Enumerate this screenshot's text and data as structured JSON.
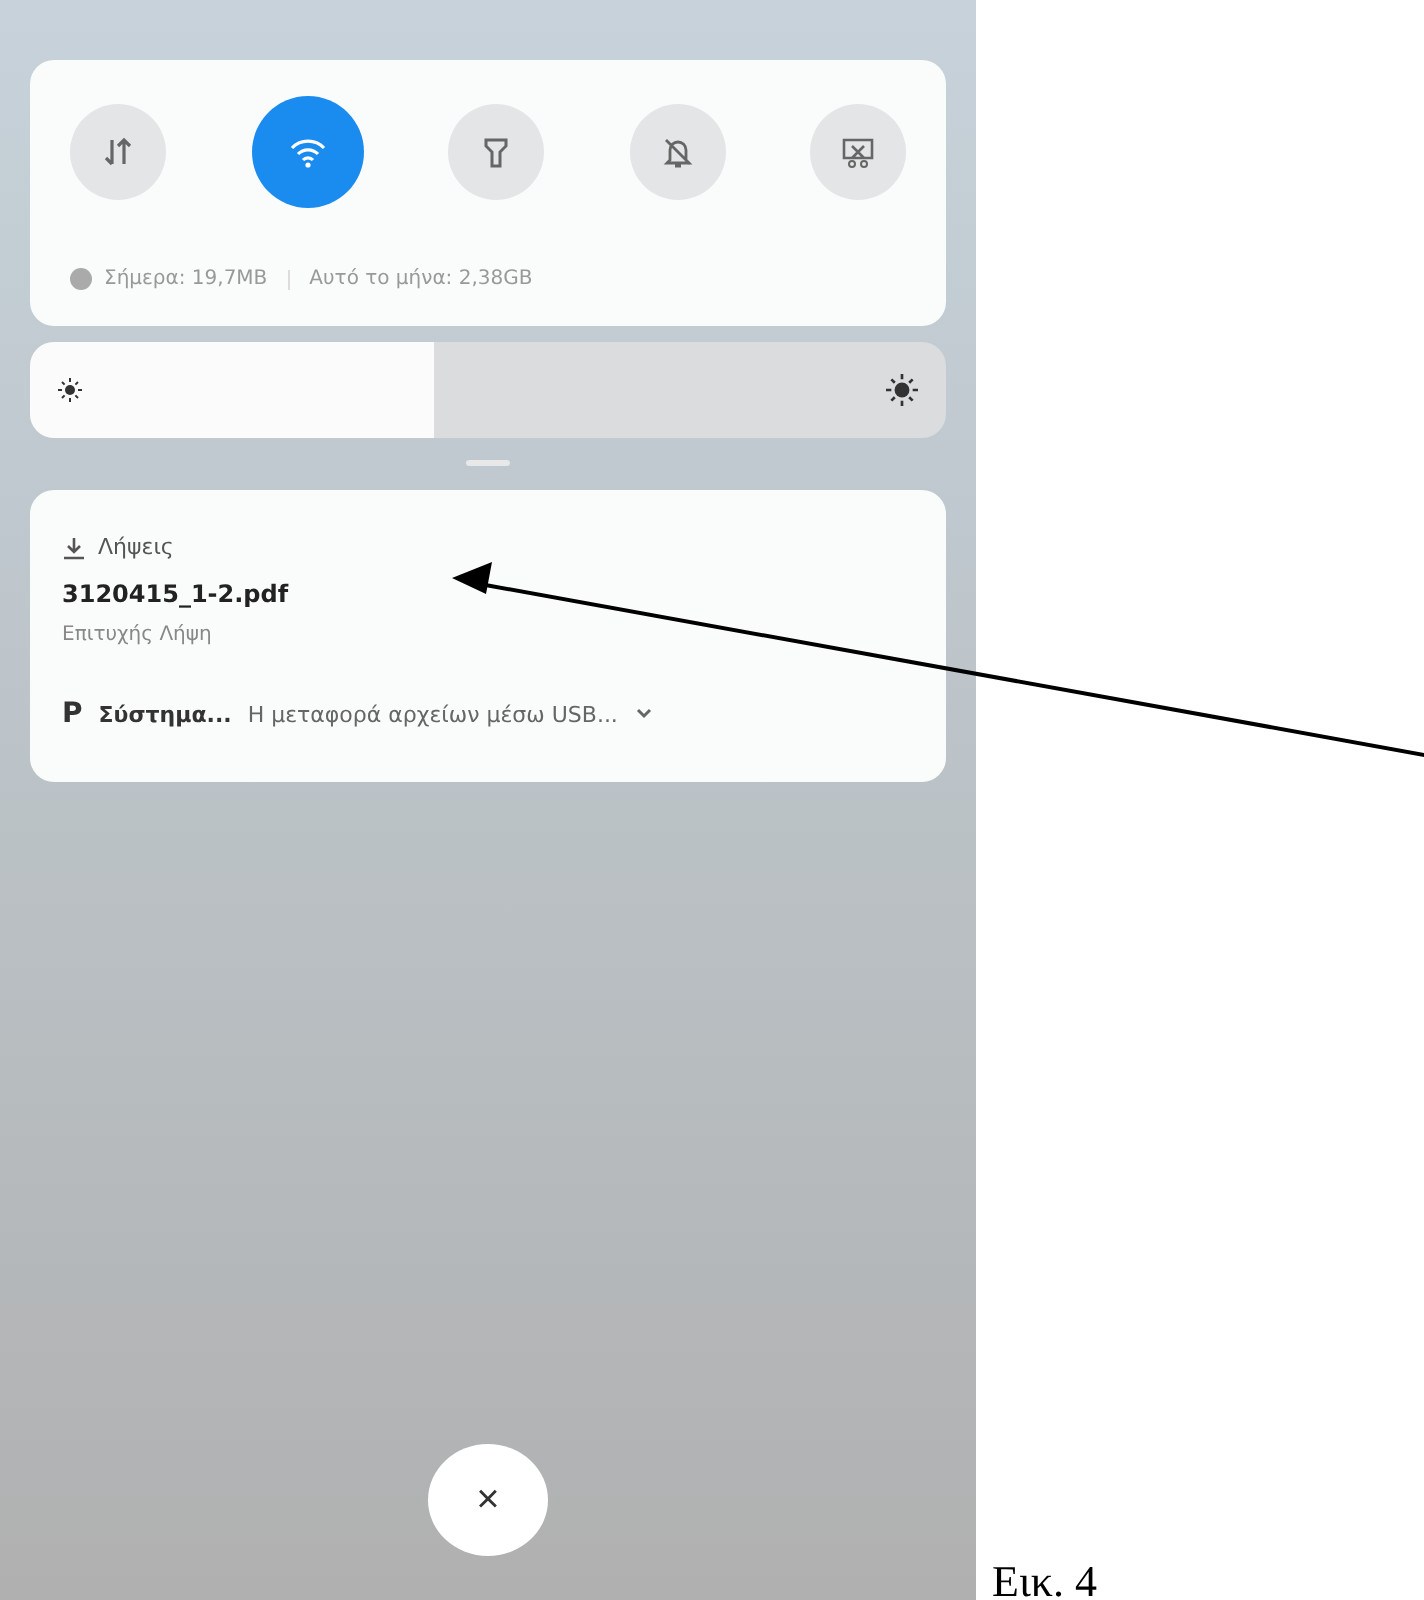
{
  "quick_settings": {
    "tiles": [
      {
        "kind": "data",
        "selected": false
      },
      {
        "kind": "wifi",
        "selected": true
      },
      {
        "kind": "flashlight",
        "selected": false
      },
      {
        "kind": "mute",
        "selected": false
      },
      {
        "kind": "screenshot",
        "selected": false
      }
    ],
    "data_usage": {
      "today": "Σήμερα: 19,7MB",
      "month": "Αυτό το μήνα: 2,38GB"
    }
  },
  "brightness": {
    "level": 0.44
  },
  "notification": {
    "app": "Λήψεις",
    "title": "3120415_1-2.pdf",
    "text": "Επιτυχής Λήψη"
  },
  "system_notification": {
    "app_letter": "P",
    "app": "Σύστημα...",
    "text": "Η μεταφορά αρχείων μέσω USB..."
  },
  "close_button": "×",
  "caption": "Εικ. 4"
}
